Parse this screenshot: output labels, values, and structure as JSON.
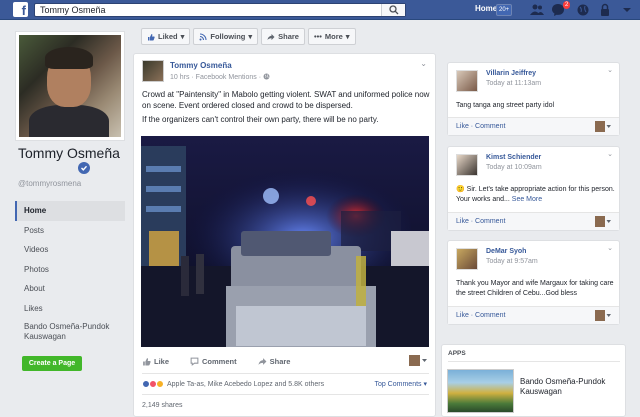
{
  "topbar": {
    "logo": "f",
    "search_value": "Tommy Osmeña",
    "home_label": "Home",
    "home_count": "20+",
    "notifications_count": "2"
  },
  "profile": {
    "name": "Tommy Osmeña",
    "handle": "@tommyrosmena"
  },
  "leftnav": {
    "items": [
      {
        "label": "Home",
        "active": true
      },
      {
        "label": "Posts"
      },
      {
        "label": "Videos"
      },
      {
        "label": "Photos"
      },
      {
        "label": "About"
      },
      {
        "label": "Likes"
      },
      {
        "label": "Bando Osmeña-Pundok Kauswagan"
      }
    ],
    "create_page": "Create a Page"
  },
  "actionbar": {
    "liked": "Liked",
    "following": "Following",
    "share": "Share",
    "more": "More"
  },
  "post": {
    "author": "Tommy Osmeña",
    "meta": "10 hrs · Facebook Mentions ·",
    "paragraphs": [
      "Crowd at \"Paintensity\" in Mabolo getting violent. SWAT and uniformed police now on scene. Event ordered closed and crowd to be dispersed.",
      "If the organizers can't control their own party, there will be no party."
    ],
    "actions": {
      "like": "Like",
      "comment": "Comment",
      "share": "Share"
    },
    "reactions_text": "Apple Ta-as, Mike Acebedo Lopez and 5.8K others",
    "top_comments": "Top Comments",
    "shares": "2,149 shares"
  },
  "comments": [
    {
      "name": "Villarin Jeiffrey",
      "time": "Today at 11:13am",
      "text": "Tang tanga ang street party idol",
      "links": "Like · Comment"
    },
    {
      "name": "Kimst Schiender",
      "time": "Today at 10:09am",
      "text": "Sir. Let's take appropriate action for this person. Your works and...",
      "see_more": "See More",
      "links": "Like · Comment"
    },
    {
      "name": "DeMar Syoh",
      "time": "Today at 9:57am",
      "text": "Thank you Mayor and wife Margaux for taking care the street Children of Cebu...God bless",
      "links": "Like · Comment"
    }
  ],
  "apps": {
    "title": "APPS",
    "item_name": "Bando Osmeña-Pundok Kauswagan"
  },
  "colors": {
    "brand_blue": "#3b5998",
    "link_blue": "#365899",
    "create_green": "#42b72a",
    "notif_red": "#fa3e3e"
  }
}
